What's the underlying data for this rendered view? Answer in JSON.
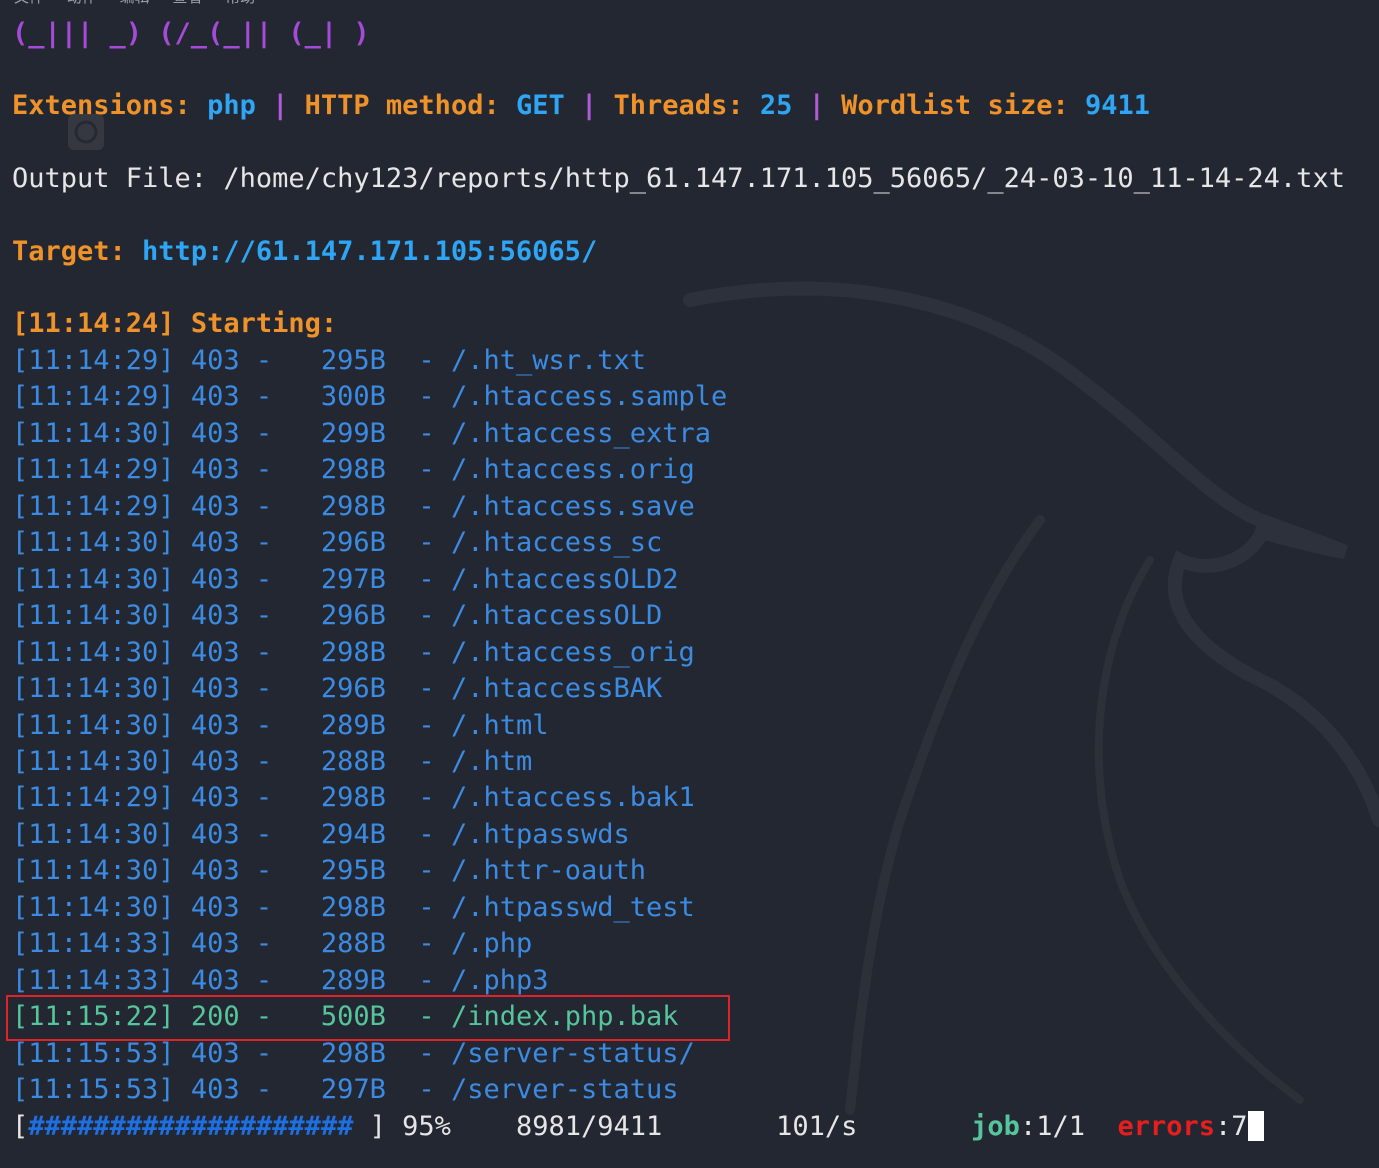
{
  "menu": [
    "文件",
    "动作",
    "编辑",
    "查看",
    "帮助"
  ],
  "banner": "(_||| _) (/_(_|| (_| )",
  "info": {
    "ext_label": "Extensions: ",
    "ext_value": "php",
    "sep": " | ",
    "method_label": "HTTP method: ",
    "method_value": "GET",
    "threads_label": "Threads: ",
    "threads_value": "25",
    "wordlist_label": "Wordlist size: ",
    "wordlist_value": "9411"
  },
  "output": {
    "label": "Output File: ",
    "path": "/home/chy123/reports/http_61.147.171.105_56065/_24-03-10_11-14-24.txt"
  },
  "target": {
    "label": "Target: ",
    "url": "http://61.147.171.105:56065/"
  },
  "start": {
    "time": "[11:14:24]",
    "label": " Starting:"
  },
  "results": [
    {
      "time": "[11:14:29]",
      "status": "403",
      "size": "295B",
      "path": "/.ht_wsr.txt"
    },
    {
      "time": "[11:14:29]",
      "status": "403",
      "size": "300B",
      "path": "/.htaccess.sample"
    },
    {
      "time": "[11:14:30]",
      "status": "403",
      "size": "299B",
      "path": "/.htaccess_extra"
    },
    {
      "time": "[11:14:29]",
      "status": "403",
      "size": "298B",
      "path": "/.htaccess.orig"
    },
    {
      "time": "[11:14:29]",
      "status": "403",
      "size": "298B",
      "path": "/.htaccess.save"
    },
    {
      "time": "[11:14:30]",
      "status": "403",
      "size": "296B",
      "path": "/.htaccess_sc"
    },
    {
      "time": "[11:14:30]",
      "status": "403",
      "size": "297B",
      "path": "/.htaccessOLD2"
    },
    {
      "time": "[11:14:30]",
      "status": "403",
      "size": "296B",
      "path": "/.htaccessOLD"
    },
    {
      "time": "[11:14:30]",
      "status": "403",
      "size": "298B",
      "path": "/.htaccess_orig"
    },
    {
      "time": "[11:14:30]",
      "status": "403",
      "size": "296B",
      "path": "/.htaccessBAK"
    },
    {
      "time": "[11:14:30]",
      "status": "403",
      "size": "289B",
      "path": "/.html"
    },
    {
      "time": "[11:14:30]",
      "status": "403",
      "size": "288B",
      "path": "/.htm"
    },
    {
      "time": "[11:14:29]",
      "status": "403",
      "size": "298B",
      "path": "/.htaccess.bak1"
    },
    {
      "time": "[11:14:30]",
      "status": "403",
      "size": "294B",
      "path": "/.htpasswds"
    },
    {
      "time": "[11:14:30]",
      "status": "403",
      "size": "295B",
      "path": "/.httr-oauth"
    },
    {
      "time": "[11:14:30]",
      "status": "403",
      "size": "298B",
      "path": "/.htpasswd_test"
    },
    {
      "time": "[11:14:33]",
      "status": "403",
      "size": "288B",
      "path": "/.php"
    },
    {
      "time": "[11:14:33]",
      "status": "403",
      "size": "289B",
      "path": "/.php3"
    },
    {
      "time": "[11:15:22]",
      "status": "200",
      "size": "500B",
      "path": "/index.php.bak"
    },
    {
      "time": "[11:15:53]",
      "status": "403",
      "size": "298B",
      "path": "/server-status/"
    },
    {
      "time": "[11:15:53]",
      "status": "403",
      "size": "297B",
      "path": "/server-status"
    }
  ],
  "progress": {
    "open": "[",
    "bar": "####################",
    "close": " ] ",
    "percent": "95%",
    "percent_value": 0.95,
    "count": "8981/9411",
    "rate": "101/s",
    "job_label": "job",
    "job_value": ":1/1",
    "errors_label": "errors",
    "errors_value": ":7"
  },
  "colors": {
    "background": "#232731",
    "label_orange": "#f0922a",
    "value_blue": "#2ea6f5",
    "separator_purple": "#b05ad8",
    "result_blue": "#3c8be2",
    "success_green": "#56c49c",
    "error_red": "#e61e1e",
    "highlight_box": "#e1222b"
  }
}
